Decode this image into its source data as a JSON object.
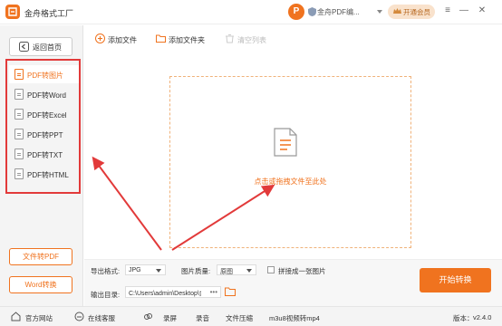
{
  "app": {
    "title": "金舟格式工厂"
  },
  "user": {
    "avatar_letter": "P",
    "name": "金舟PDF编..."
  },
  "vip": {
    "label": "开通会员"
  },
  "sidebar": {
    "home_label": "返回首页",
    "items": [
      {
        "label": "PDF转图片",
        "active": true
      },
      {
        "label": "PDF转Word"
      },
      {
        "label": "PDF转Excel"
      },
      {
        "label": "PDF转PPT"
      },
      {
        "label": "PDF转TXT"
      },
      {
        "label": "PDF转HTML"
      }
    ],
    "bottom_buttons": [
      {
        "label": "文件转PDF"
      },
      {
        "label": "Word转换"
      }
    ]
  },
  "toolbar": {
    "add_file": "添加文件",
    "add_folder": "添加文件夹",
    "clear_list": "清空列表"
  },
  "dropzone": {
    "hint": "点击或拖拽文件至此处"
  },
  "settings": {
    "format_label": "导出格式:",
    "format_value": "JPG",
    "quality_label": "图片质量:",
    "quality_value": "原图",
    "merge_label": "拼接成一张图片",
    "output_label": "输出目录:",
    "output_path": "C:\\Users\\admin\\Desktop\\金",
    "more": "•••"
  },
  "start_button": "开始转换",
  "statusbar": {
    "website": "官方网站",
    "support": "在线客服",
    "tools": [
      "录屏",
      "录音",
      "文件压缩",
      "m3u8视频转mp4"
    ],
    "version_label": "版本：",
    "version_value": "v2.4.0"
  },
  "colors": {
    "accent": "#f0731f",
    "highlight": "#e23a3a"
  }
}
